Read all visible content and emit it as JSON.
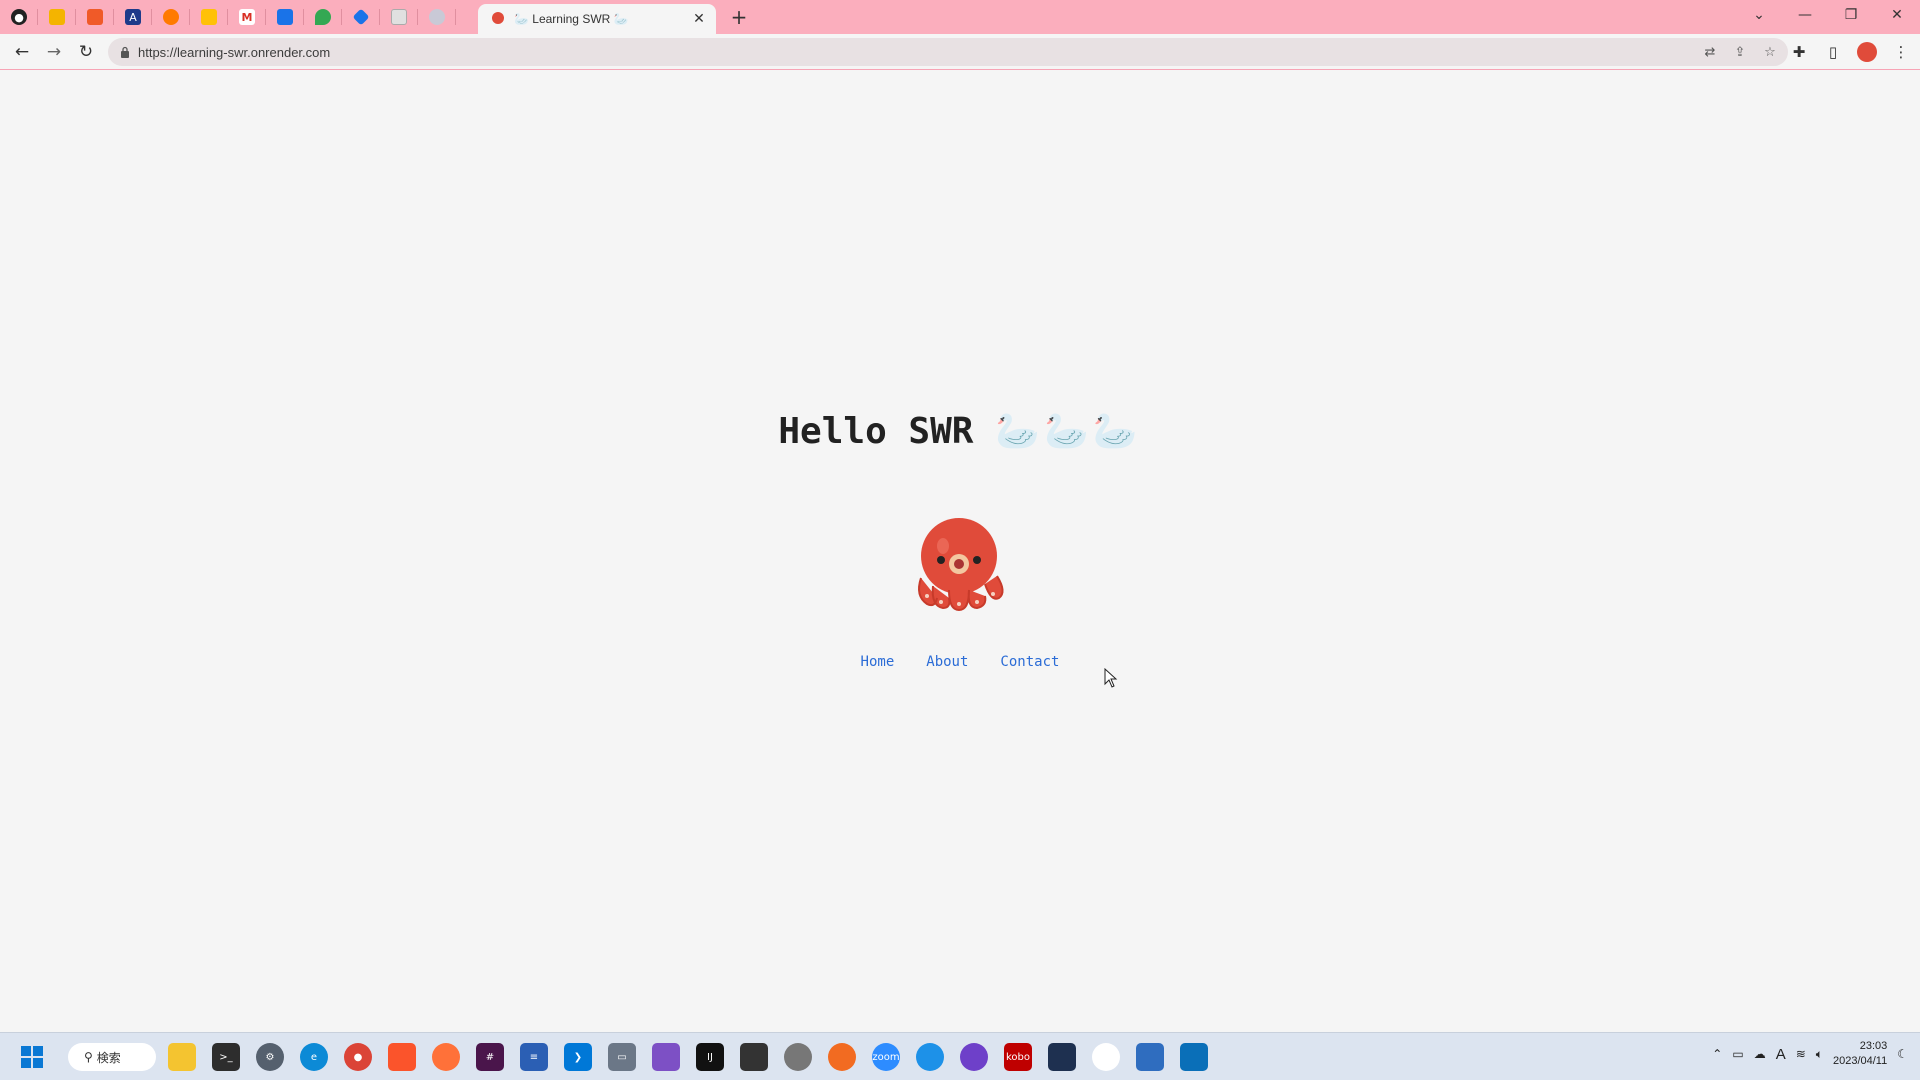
{
  "browser": {
    "active_tab_title": "🦢 Learning SWR 🦢",
    "url": "https://learning-swr.onrender.com",
    "pinned_tabs": [
      "github",
      "app-2",
      "app-3",
      "app-4",
      "app-5",
      "app-6",
      "gmail",
      "app-8",
      "maps",
      "app-10",
      "app-11",
      "app-12"
    ]
  },
  "page": {
    "heading": "Hello SWR",
    "heading_emoji": "🦢🦢🦢",
    "nav": [
      {
        "label": "Home"
      },
      {
        "label": "About"
      },
      {
        "label": "Contact"
      }
    ],
    "link_color": "#2b6cd6"
  },
  "taskbar": {
    "search_label": "検索",
    "time": "23:03",
    "date": "2023/04/11",
    "ime": "A"
  },
  "colors": {
    "tabstrip": "#fbaebd",
    "page_bg": "#f5f5f5",
    "octopus": "#e04b3a"
  }
}
